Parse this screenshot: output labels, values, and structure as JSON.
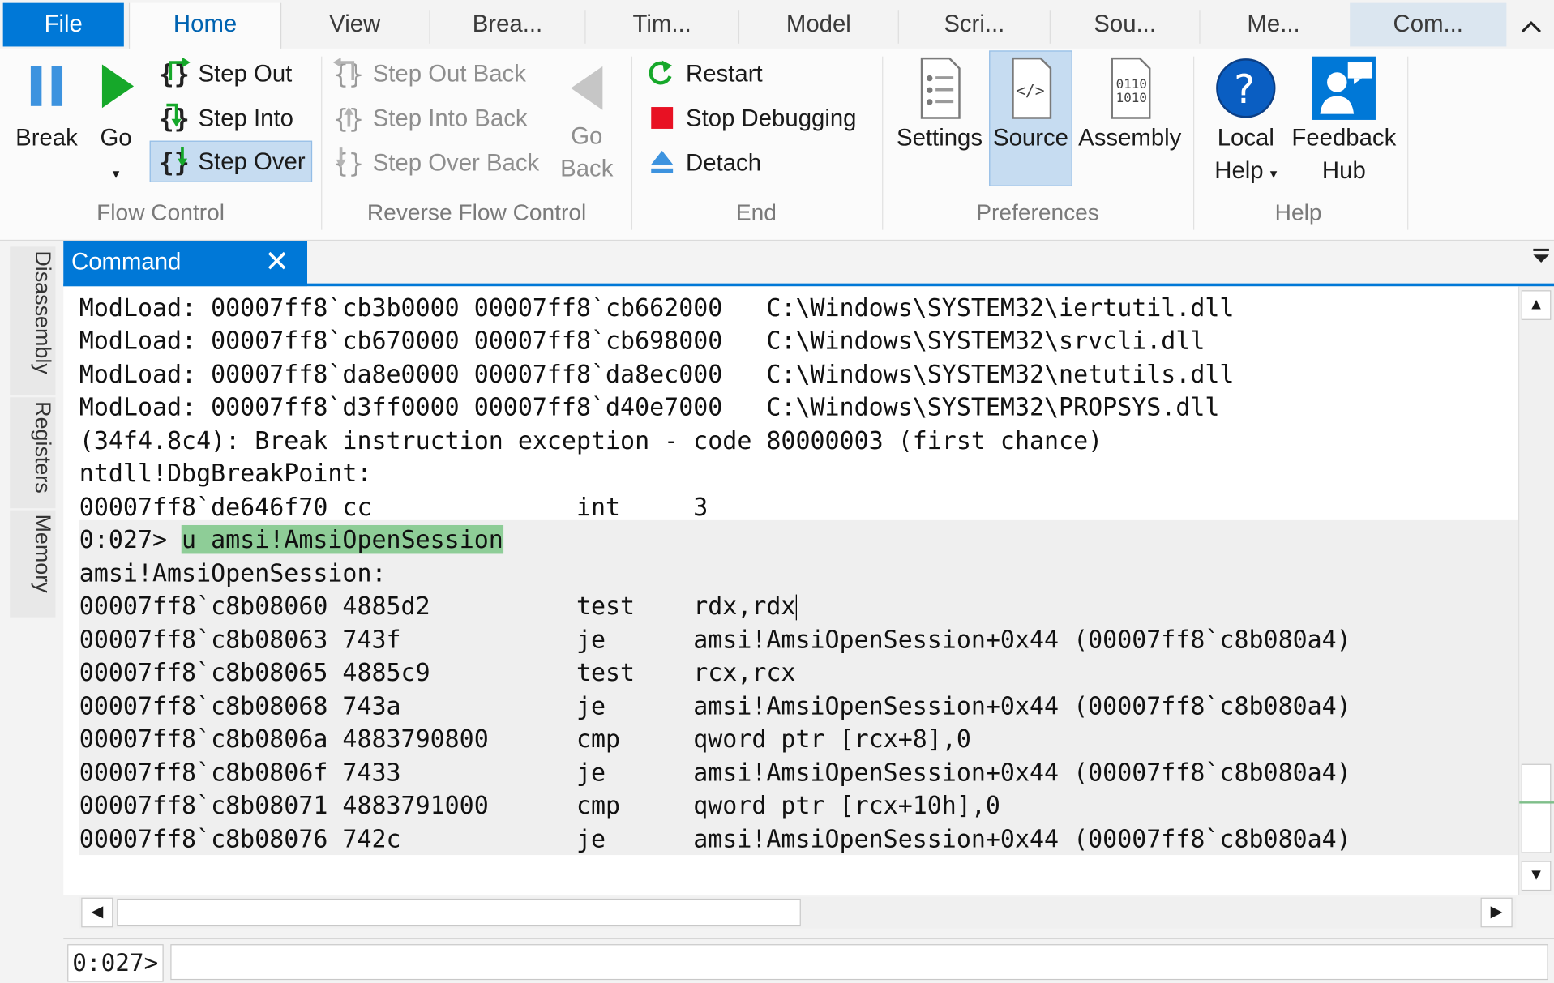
{
  "tabs": [
    {
      "label": "File",
      "name": "tab-file"
    },
    {
      "label": "Home",
      "name": "tab-home"
    },
    {
      "label": "View",
      "name": "tab-view"
    },
    {
      "label": "Brea...",
      "name": "tab-breakpoints"
    },
    {
      "label": "Tim...",
      "name": "tab-time-travel"
    },
    {
      "label": "Model",
      "name": "tab-model"
    },
    {
      "label": "Scri...",
      "name": "tab-scripting"
    },
    {
      "label": "Sou...",
      "name": "tab-source"
    },
    {
      "label": "Me...",
      "name": "tab-memory"
    },
    {
      "label": "Com...",
      "name": "tab-command"
    }
  ],
  "ribbon": {
    "flow": {
      "break": "Break",
      "go": "Go",
      "step_out": "Step Out",
      "step_into": "Step Into",
      "step_over": "Step Over",
      "group": "Flow Control"
    },
    "reverse": {
      "step_out_back": "Step Out Back",
      "step_into_back": "Step Into Back",
      "step_over_back": "Step Over Back",
      "go_back_1": "Go",
      "go_back_2": "Back",
      "group": "Reverse Flow Control"
    },
    "end": {
      "restart": "Restart",
      "stop": "Stop Debugging",
      "detach": "Detach",
      "group": "End"
    },
    "prefs": {
      "settings": "Settings",
      "source": "Source",
      "assembly": "Assembly",
      "group": "Preferences"
    },
    "help": {
      "local_1": "Local",
      "local_2": "Help",
      "feedback_1": "Feedback",
      "feedback_2": "Hub",
      "group": "Help"
    }
  },
  "side_tabs": [
    "Disassembly",
    "Registers",
    "Memory"
  ],
  "command_window": {
    "title": "Command",
    "lines": [
      "ModLoad: 00007ff8`cb3b0000 00007ff8`cb662000   C:\\Windows\\SYSTEM32\\iertutil.dll",
      "ModLoad: 00007ff8`cb670000 00007ff8`cb698000   C:\\Windows\\SYSTEM32\\srvcli.dll",
      "ModLoad: 00007ff8`da8e0000 00007ff8`da8ec000   C:\\Windows\\SYSTEM32\\netutils.dll",
      "ModLoad: 00007ff8`d3ff0000 00007ff8`d40e7000   C:\\Windows\\SYSTEM32\\PROPSYS.dll",
      "(34f4.8c4): Break instruction exception - code 80000003 (first chance)",
      "ntdll!DbgBreakPoint:",
      "00007ff8`de646f70 cc              int     3"
    ],
    "prompt_line": {
      "prefix": "0:027> ",
      "command": "u amsi!AmsiOpenSession"
    },
    "lines2": [
      "amsi!AmsiOpenSession:",
      "00007ff8`c8b08060 4885d2          test    rdx,rdx",
      "00007ff8`c8b08063 743f            je      amsi!AmsiOpenSession+0x44 (00007ff8`c8b080a4)",
      "00007ff8`c8b08065 4885c9          test    rcx,rcx",
      "00007ff8`c8b08068 743a            je      amsi!AmsiOpenSession+0x44 (00007ff8`c8b080a4)",
      "00007ff8`c8b0806a 4883790800      cmp     qword ptr [rcx+8],0",
      "00007ff8`c8b0806f 7433            je      amsi!AmsiOpenSession+0x44 (00007ff8`c8b080a4)",
      "00007ff8`c8b08071 4883791000      cmp     qword ptr [rcx+10h],0",
      "00007ff8`c8b08076 742c            je      amsi!AmsiOpenSession+0x44 (00007ff8`c8b080a4)"
    ],
    "input_prompt": "0:027>",
    "input_value": ""
  },
  "colors": {
    "accent": "#0078d7",
    "highlight": "#8ecd97",
    "stop": "#e81123",
    "go": "#16a82a"
  }
}
